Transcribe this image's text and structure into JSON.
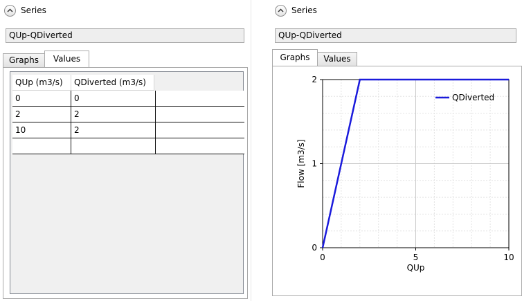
{
  "left": {
    "section_title": "Series",
    "series_name": "QUp-QDiverted",
    "tabs": [
      {
        "label": "Graphs"
      },
      {
        "label": "Values"
      }
    ],
    "active_tab": "Values",
    "table": {
      "columns": [
        "QUp (m3/s)",
        "QDiverted (m3/s)",
        ""
      ],
      "rows": [
        [
          "0",
          "0",
          ""
        ],
        [
          "2",
          "2",
          ""
        ],
        [
          "10",
          "2",
          ""
        ],
        [
          "",
          "",
          ""
        ]
      ]
    }
  },
  "right": {
    "section_title": "Series",
    "series_name": "QUp-QDiverted",
    "tabs": [
      {
        "label": "Graphs"
      },
      {
        "label": "Values"
      }
    ],
    "active_tab": "Graphs"
  },
  "colors": {
    "series": "#1a1adc",
    "grid": "#c8c8c8"
  },
  "chart_data": {
    "type": "line",
    "xlabel": "QUp",
    "ylabel": "Flow [m3/s]",
    "xlim": [
      0,
      10
    ],
    "ylim": [
      0,
      2
    ],
    "x_ticks": [
      "0",
      "5",
      "10"
    ],
    "y_ticks": [
      "0",
      "1",
      "2"
    ],
    "grid": true,
    "legend_position": "top-right",
    "series": [
      {
        "name": "QDiverted",
        "x": [
          0,
          2,
          10
        ],
        "y": [
          0,
          2,
          2
        ]
      }
    ]
  }
}
